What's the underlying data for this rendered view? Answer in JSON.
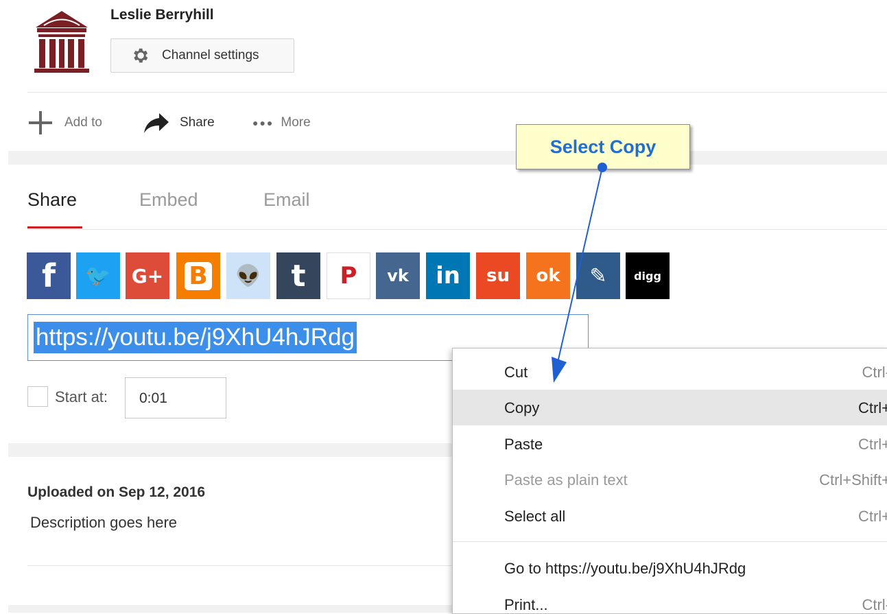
{
  "channel": {
    "name": "Leslie Berryhill",
    "settings_label": "Channel settings",
    "logo_color": "#7a1f24"
  },
  "actions": {
    "add_to": "Add to",
    "share": "Share",
    "more": "More"
  },
  "tabs": [
    {
      "label": "Share",
      "active": true
    },
    {
      "label": "Embed",
      "active": false
    },
    {
      "label": "Email",
      "active": false
    }
  ],
  "social_icons": [
    {
      "name": "facebook-icon",
      "glyph": "f",
      "color": "#3b5998"
    },
    {
      "name": "twitter-icon",
      "glyph": "🐦",
      "color": "#1da1f2"
    },
    {
      "name": "google-plus-icon",
      "glyph": "G+",
      "color": "#dd4b39"
    },
    {
      "name": "blogger-icon",
      "glyph": "B",
      "color": "#f57d00"
    },
    {
      "name": "reddit-icon",
      "glyph": "👽",
      "color": "#cee3f8"
    },
    {
      "name": "tumblr-icon",
      "glyph": "t",
      "color": "#35465c"
    },
    {
      "name": "pinterest-icon",
      "glyph": "P",
      "color": "#ffffff"
    },
    {
      "name": "vk-icon",
      "glyph": "vk",
      "color": "#45668e"
    },
    {
      "name": "linkedin-icon",
      "glyph": "in",
      "color": "#0077b5"
    },
    {
      "name": "stumbleupon-icon",
      "glyph": "su",
      "color": "#eb4924"
    },
    {
      "name": "odnoklassniki-icon",
      "glyph": "ok",
      "color": "#f4731c"
    },
    {
      "name": "livejournal-icon",
      "glyph": "✎",
      "color": "#2f5b8a"
    },
    {
      "name": "digg-icon",
      "glyph": "digg",
      "color": "#000000"
    }
  ],
  "url_field": {
    "value": "https://youtu.be/j9XhU4hJRdg",
    "selected": true
  },
  "start_at": {
    "label": "Start at:",
    "value": "0:01",
    "checked": false
  },
  "description": {
    "uploaded": "Uploaded on Sep 12, 2016",
    "text": "Description goes here"
  },
  "context_menu": {
    "items": [
      {
        "label": "Cut",
        "shortcut": "Ctrl-",
        "disabled": false,
        "hover": false
      },
      {
        "label": "Copy",
        "shortcut": "Ctrl+",
        "disabled": false,
        "hover": true
      },
      {
        "label": "Paste",
        "shortcut": "Ctrl+",
        "disabled": false,
        "hover": false
      },
      {
        "label": "Paste as plain text",
        "shortcut": "Ctrl+Shift+",
        "disabled": true,
        "hover": false
      },
      {
        "label": "Select all",
        "shortcut": "Ctrl+",
        "disabled": false,
        "hover": false
      },
      {
        "label": "Go to https://youtu.be/j9XhU4hJRdg",
        "shortcut": "",
        "disabled": false,
        "hover": false
      },
      {
        "label": "Print...",
        "shortcut": "Ctrl-",
        "disabled": false,
        "hover": false
      }
    ]
  },
  "callout": {
    "text": "Select Copy",
    "color": "#1f6ed4",
    "background": "#ffffcc"
  }
}
